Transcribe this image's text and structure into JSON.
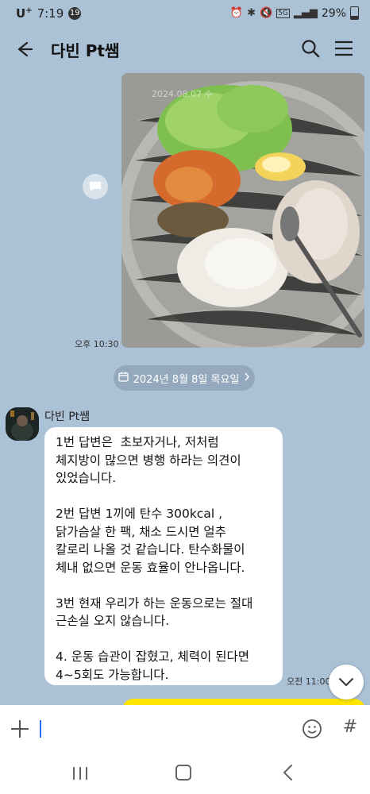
{
  "status_bar": {
    "carrier": "U",
    "carrier_sup": "+",
    "time": "7:19",
    "notification_count": "19",
    "network": "5G",
    "battery": "29%",
    "battery_level": 0.29
  },
  "header": {
    "title": "다빈 Pt쌤",
    "icons": [
      "back-arrow-icon",
      "search-icon",
      "menu-icon"
    ]
  },
  "photo_message": {
    "date_stamp": "2024.08.07 수",
    "time": "오후 10:30"
  },
  "date_divider": {
    "label": "2024년 8월 8일 목요일"
  },
  "incoming": {
    "sender": "다빈 Pt쌤",
    "paragraphs": [
      "1번 답변은  초보자거나, 저처럼\n체지방이 많으면 병행 하라는 의견이\n있었습니다.",
      "2번 답변 1끼에 탄수 300kcal ,\n닭가슴살 한 팩, 채소 드시면 얼추\n칼로리 나올 것 같습니다. 탄수화물이\n체내 없으면 운동 효율이 안나옵니다.",
      "3번 현재 우리가 하는 운동으로는 절대\n근손실 오지 않습니다.",
      "4. 운동 습관이 잡혔고, 체력이 된다면\n4~5회도 가능합니다."
    ],
    "time": "오전 11:00"
  },
  "input_bar": {
    "placeholder": "",
    "value": ""
  },
  "colors": {
    "chat_background": "#abc1d6",
    "my_bubble": "#fee500",
    "incoming_bubble": "#ffffff",
    "caret": "#2a6cf5"
  }
}
